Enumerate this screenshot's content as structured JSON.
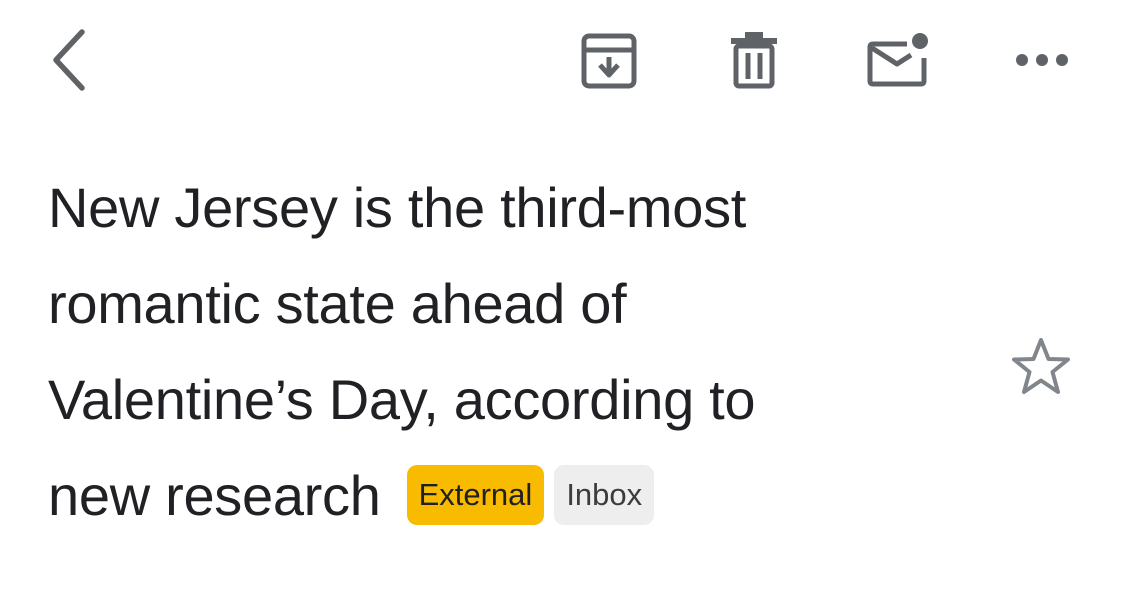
{
  "toolbar": {
    "back_icon": "chevron-left-icon",
    "archive_icon": "archive-icon",
    "delete_icon": "trash-icon",
    "mark_unread_icon": "mail-unread-icon",
    "more_icon": "more-horizontal-icon",
    "icon_color": "#5f6368"
  },
  "message": {
    "subject_lines": [
      "New Jersey is the third-most",
      "romantic state ahead of",
      "Valentine’s Day, according to",
      "new research"
    ],
    "labels": [
      {
        "text": "External",
        "color": "#f9bb00"
      },
      {
        "text": "Inbox",
        "color": "#eeeeee"
      }
    ],
    "star_icon": "star-outline-icon",
    "starred": false
  }
}
